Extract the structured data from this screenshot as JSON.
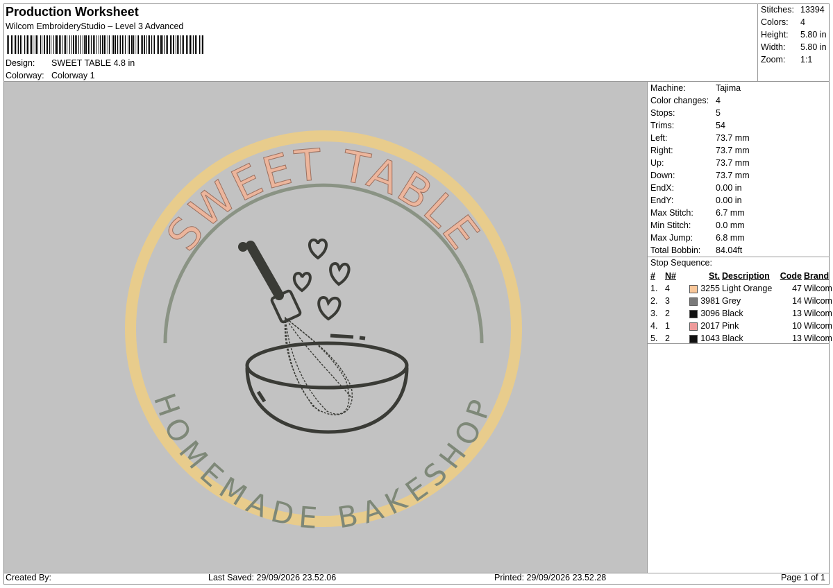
{
  "header": {
    "title": "Production Worksheet",
    "software": "Wilcom EmbroideryStudio – Level 3 Advanced",
    "design_label": "Design:",
    "design_value": "SWEET TABLE 4.8 in",
    "colorway_label": "Colorway:",
    "colorway_value": "Colorway 1"
  },
  "summary": [
    {
      "label": "Stitches:",
      "value": "13394"
    },
    {
      "label": "Colors:",
      "value": "4"
    },
    {
      "label": "Height:",
      "value": "5.80 in"
    },
    {
      "label": "Width:",
      "value": "5.80 in"
    },
    {
      "label": "Zoom:",
      "value": "1:1"
    }
  ],
  "machine": [
    {
      "label": "Machine:",
      "value": "Tajima"
    },
    {
      "label": "Color changes:",
      "value": "4"
    },
    {
      "label": "Stops:",
      "value": "5"
    },
    {
      "label": "Trims:",
      "value": "54"
    },
    {
      "label": "Left:",
      "value": "73.7 mm"
    },
    {
      "label": "Right:",
      "value": "73.7 mm"
    },
    {
      "label": "Up:",
      "value": "73.7 mm"
    },
    {
      "label": "Down:",
      "value": "73.7 mm"
    },
    {
      "label": "EndX:",
      "value": "0.00 in"
    },
    {
      "label": "EndY:",
      "value": "0.00 in"
    },
    {
      "label": "Max Stitch:",
      "value": "6.7 mm"
    },
    {
      "label": "Min Stitch:",
      "value": "0.0 mm"
    },
    {
      "label": "Max Jump:",
      "value": "6.8 mm"
    },
    {
      "label": "Total Bobbin:",
      "value": "84.04ft"
    }
  ],
  "stop_sequence": {
    "title": "Stop Sequence:",
    "columns": [
      "#",
      "N#",
      "St.",
      "Description",
      "Code",
      "Brand"
    ],
    "rows": [
      {
        "num": "1.",
        "n": "4",
        "st": "3255",
        "color": "#f9c79a",
        "desc": "Light Orange",
        "code": "47",
        "brand": "Wilcom"
      },
      {
        "num": "2.",
        "n": "3",
        "st": "3981",
        "color": "#7a7a7a",
        "desc": "Grey",
        "code": "14",
        "brand": "Wilcom"
      },
      {
        "num": "3.",
        "n": "2",
        "st": "3096",
        "color": "#111111",
        "desc": "Black",
        "code": "13",
        "brand": "Wilcom"
      },
      {
        "num": "4.",
        "n": "1",
        "st": "2017",
        "color": "#ee9a9a",
        "desc": "Pink",
        "code": "10",
        "brand": "Wilcom"
      },
      {
        "num": "5.",
        "n": "2",
        "st": "1043",
        "color": "#111111",
        "desc": "Black",
        "code": "13",
        "brand": "Wilcom"
      }
    ]
  },
  "design_preview": {
    "top_text": "SWEET TABLE",
    "bottom_text": "HOMEMADE BAKESHOP",
    "ring_color": "#e8cc8c",
    "top_text_color": "#ecb59c",
    "inner_arc_color": "#8a9384",
    "bottom_text_color": "#7e8878",
    "line_color": "#3a3b36",
    "canvas_color": "#c2c2c2"
  },
  "footer": {
    "created_by": "Created By:",
    "last_saved": "Last Saved: 29/09/2026 23.52.06",
    "printed": "Printed: 29/09/2026 23.52.28",
    "page": "Page 1 of 1"
  }
}
